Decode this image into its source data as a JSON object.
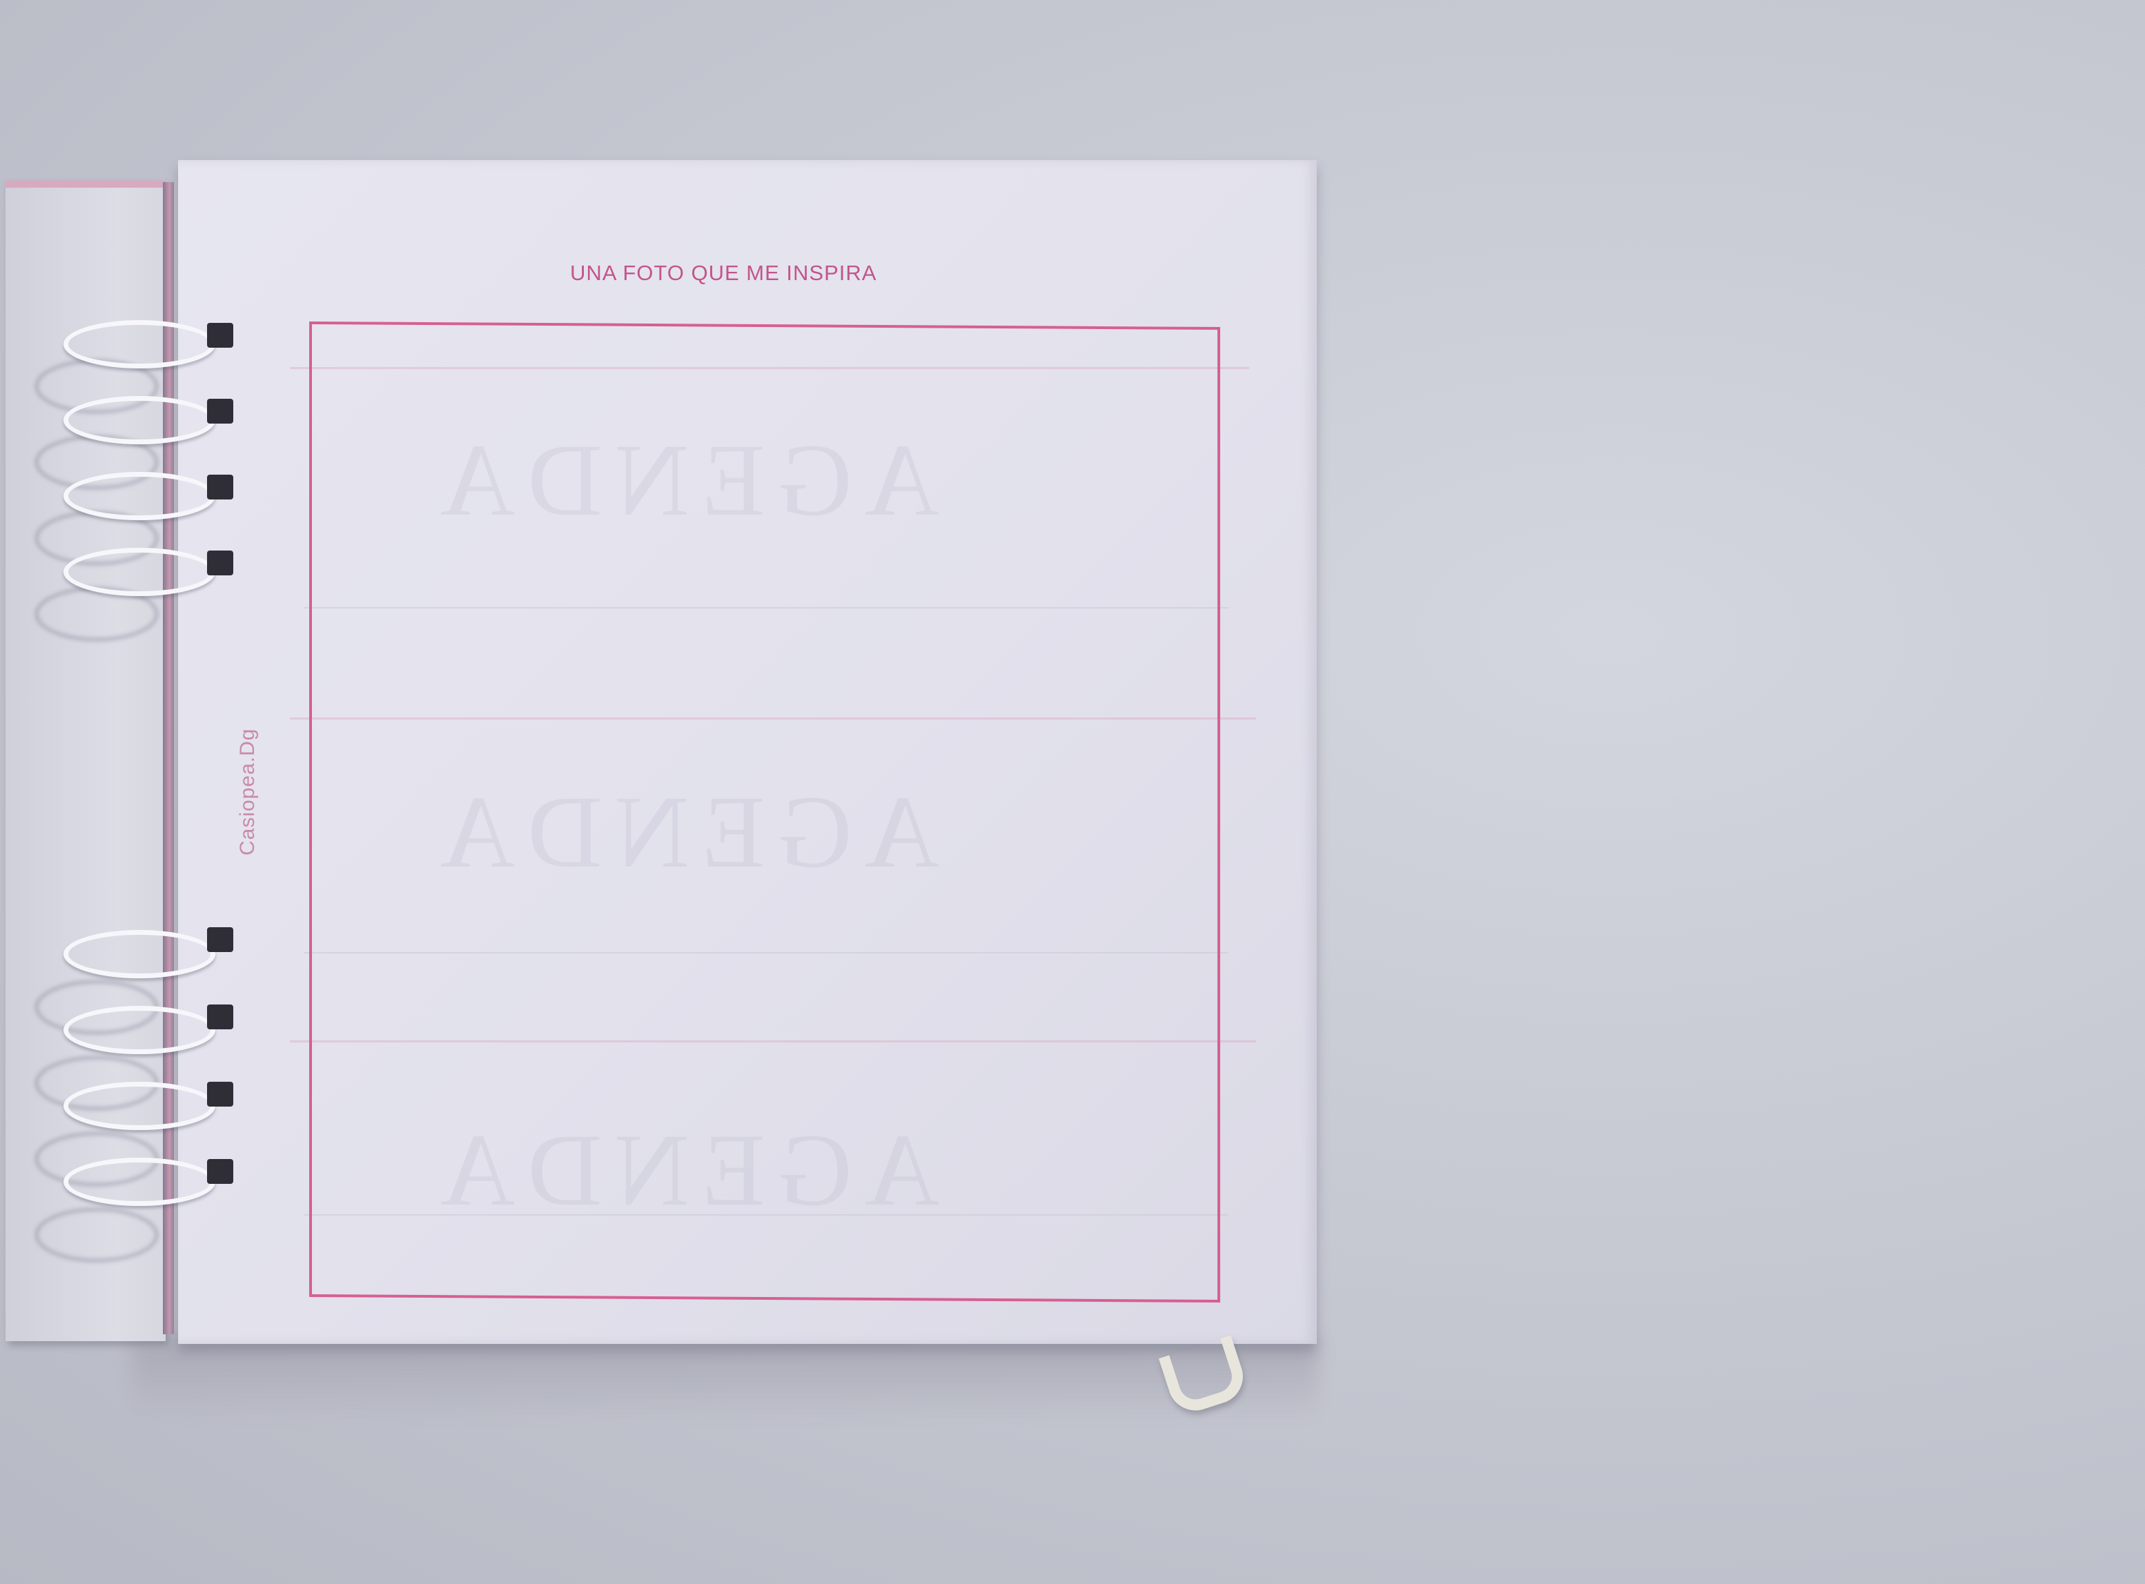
{
  "page": {
    "title": "UNA FOTO QUE ME INSPIRA",
    "brand": "Casiopea.Dg"
  },
  "colors": {
    "accent_pink": "#d65f92",
    "title_pink": "#c2558c",
    "background": "#c6c8d2",
    "paper": "#e4e3ee"
  },
  "icons": {
    "binding": "spiral-binding-icon",
    "ribbon": "ribbon-bookmark-icon"
  }
}
